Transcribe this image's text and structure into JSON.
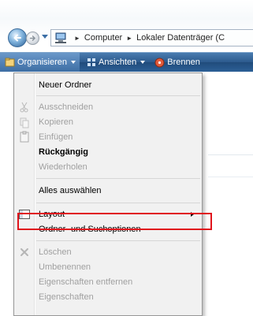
{
  "address_bar": {
    "segments": [
      "Computer",
      "Lokaler Datenträger (C"
    ]
  },
  "command_bar": {
    "organize_label": "Organisieren",
    "views_label": "Ansichten",
    "burn_label": "Brennen"
  },
  "menu": {
    "items": [
      {
        "label": "Neuer Ordner"
      },
      {
        "label": "Ausschneiden"
      },
      {
        "label": "Kopieren"
      },
      {
        "label": "Einfügen"
      },
      {
        "label": "Rückgängig"
      },
      {
        "label": "Wiederholen"
      },
      {
        "label": "Alles auswählen"
      },
      {
        "label": "Layout"
      },
      {
        "label": "Ordner- und Suchoptionen"
      },
      {
        "label": "Löschen"
      },
      {
        "label": "Umbenennen"
      },
      {
        "label": "Eigenschaften entfernen"
      },
      {
        "label": "Eigenschaften"
      }
    ]
  },
  "colors": {
    "command_bar": "#2c5a8d",
    "highlight_border": "#e0141c",
    "disabled_text": "#a0a0a0"
  }
}
